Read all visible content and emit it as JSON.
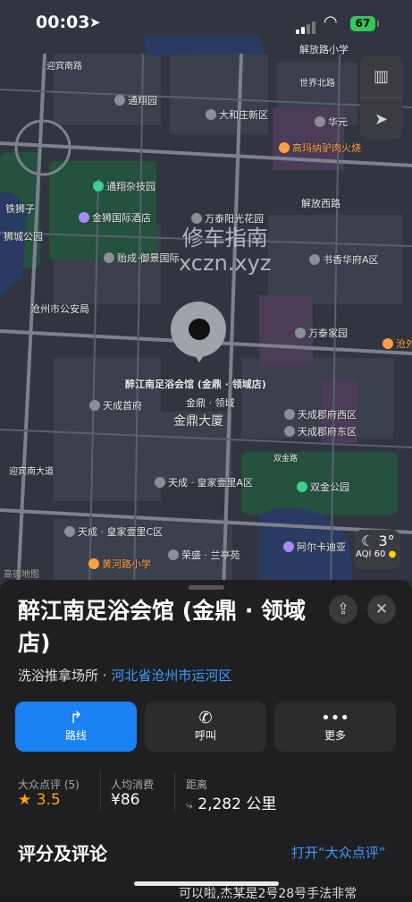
{
  "status_bar": {
    "time": "00:03",
    "battery": "67"
  },
  "map": {
    "labels": [
      {
        "text": "解放路小学",
        "cls": "t1"
      },
      {
        "text": "迎宾南路",
        "cls": "t2"
      },
      {
        "text": "通翔园",
        "cls": "t3"
      },
      {
        "text": "大和庄新区",
        "cls": "t4"
      },
      {
        "text": "华元",
        "cls": "t5"
      },
      {
        "text": "世界北路",
        "cls": "t6"
      },
      {
        "text": "高玛纳驴肉火烧",
        "cls": "t7"
      },
      {
        "text": "通翔杂技园",
        "cls": "t8"
      },
      {
        "text": "解放西路",
        "cls": "t9"
      },
      {
        "text": "铁狮子",
        "cls": "t10"
      },
      {
        "text": "金狮国际酒店",
        "cls": "t11"
      },
      {
        "text": "万泰阳光花园",
        "cls": "t12"
      },
      {
        "text": "狮城公园",
        "cls": "t13"
      },
      {
        "text": "贻成·御景国际",
        "cls": "t14"
      },
      {
        "text": "书香华府A区",
        "cls": "t15"
      },
      {
        "text": "沧州市公安局",
        "cls": "t16"
      },
      {
        "text": "万泰家园",
        "cls": "t17"
      },
      {
        "text": "沧外",
        "cls": "t18"
      },
      {
        "text": "醉江南足浴会馆 (金鼎 · 领域店)",
        "cls": "t19"
      },
      {
        "text": "金鼎 · 领域",
        "cls": "t20"
      },
      {
        "text": "天成首府",
        "cls": "t21"
      },
      {
        "text": "天成郡府西区",
        "cls": "t22"
      },
      {
        "text": "金鼎大厦",
        "cls": "t23"
      },
      {
        "text": "天成郡府东区",
        "cls": "t24"
      },
      {
        "text": "双金路",
        "cls": "t25"
      },
      {
        "text": "天成 · 皇家壹里A区",
        "cls": "t26"
      },
      {
        "text": "双金公园",
        "cls": "t27"
      },
      {
        "text": "迎宾南大道",
        "cls": "t28"
      },
      {
        "text": "天成 · 皇家壹里C区",
        "cls": "t29"
      },
      {
        "text": "阿尔卡迪亚",
        "cls": "t30"
      },
      {
        "text": "荣盛 · 兰亭苑",
        "cls": "t31"
      },
      {
        "text": "黄河路小学",
        "cls": "t32"
      },
      {
        "text": "高德地图",
        "cls": "t33"
      }
    ],
    "watermark_line1": "修车指南",
    "watermark_line2": "xczn.xyz",
    "weather": {
      "temp": "3°",
      "aqi": "AQI 60"
    }
  },
  "place": {
    "title": "醉江南足浴会馆 (金鼎 · 领域店)",
    "category": "洗浴推拿场所",
    "separator": " · ",
    "region": "河北省沧州市运河区"
  },
  "actions": [
    {
      "label": "路线"
    },
    {
      "label": "呼叫"
    },
    {
      "label": "更多"
    }
  ],
  "stats": [
    {
      "header": "大众点评 (5)",
      "value": "3.5"
    },
    {
      "header": "人均消费",
      "value": "¥86"
    },
    {
      "header": "距离",
      "value": "2,282 公里"
    }
  ],
  "reviews": {
    "title": "评分及评论",
    "open_link": "打开“大众点评”",
    "peek_text": "可以啦,杰某是2号28号手法非常"
  },
  "colors": {
    "accent": "#1a82f3",
    "star": "#ffa500"
  }
}
